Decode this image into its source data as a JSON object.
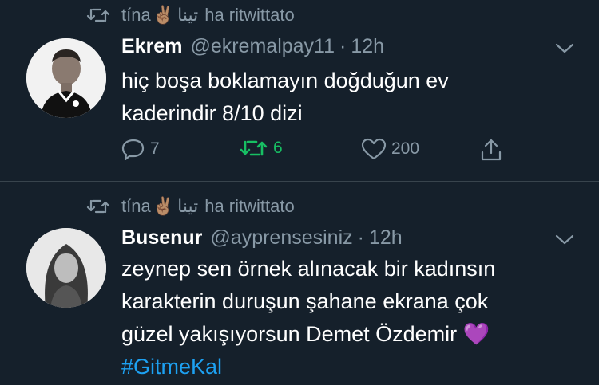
{
  "tweets": [
    {
      "retweeted_by": "tína",
      "retweeted_by_arabic": "تينا",
      "retweet_label": "ha ritwittato",
      "author_name": "Ekrem",
      "author_handle": "@ekremalpay11",
      "separator": "·",
      "time": "12h",
      "text_lines": [
        "hiç boşa boklamayın doğduğun ev",
        "kaderindir 8/10 dizi"
      ],
      "reply_count": "7",
      "retweet_count": "6",
      "like_count": "200",
      "retweeted_state_color": "#17bf63"
    },
    {
      "retweeted_by": "tína",
      "retweeted_by_arabic": "تينا",
      "retweet_label": "ha ritwittato",
      "author_name": "Busenur",
      "author_handle": "@ayprensesiniz",
      "separator": "·",
      "time": "12h",
      "text_lines": [
        "zeynep sen örnek alınacak bir kadınsın",
        "karakterin duruşun şahane ekrana çok",
        "güzel yakışıyorsun Demet Özdemir"
      ],
      "text_emoji": "💜",
      "hashtag": "#GitmeKal"
    }
  ],
  "colors": {
    "background": "#15202b",
    "secondary_text": "#8899a6",
    "link": "#1da1f2",
    "divider": "#38444d"
  },
  "icons": [
    "retweet-icon",
    "victory-hand-emoji",
    "chevron-down-icon",
    "reply-icon",
    "like-icon",
    "share-icon"
  ]
}
